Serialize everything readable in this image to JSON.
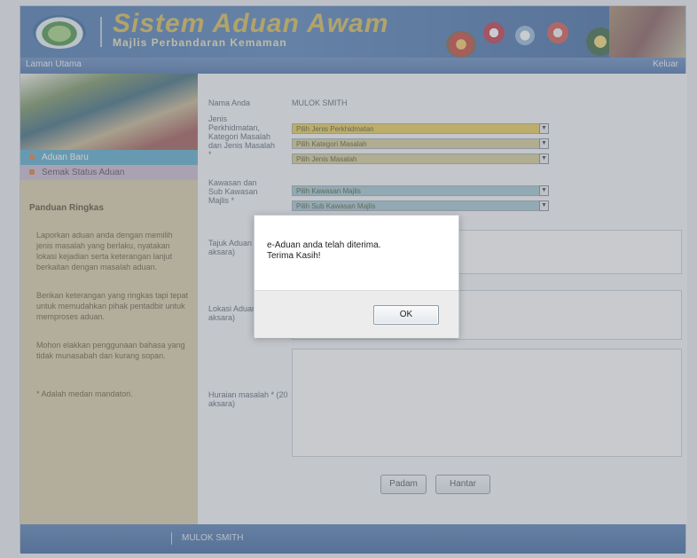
{
  "header": {
    "title": "Sistem Aduan Awam",
    "subtitle": "Majlis Perbandaran Kemaman"
  },
  "menubar": {
    "home": "Laman Utama",
    "logout": "Keluar"
  },
  "sidebar": {
    "nav": [
      {
        "label": "Aduan Baru"
      },
      {
        "label": "Semak Status Aduan"
      }
    ],
    "guide_title": "Panduan Ringkas",
    "guide": [
      "Laporkan aduan anda dengan memilih jenis masalah yang berlaku, nyatakan lokasi kejadian serta keterangan lanjut berkaitan dengan masalah aduan.",
      "Berikan keterangan yang ringkas tapi tepat untuk memudahkan pihak pentadbir untuk memproses aduan.",
      "Mohon elakkan penggunaan bahasa yang tidak munasabah dan kurang sopan.",
      "* Adalah medan mandatori."
    ]
  },
  "form": {
    "name_label": "Nama Anda",
    "name_value": "MULOK SMITH",
    "category_label": "Jenis Perkhidmatan, Kategori Masalah dan Jenis Masalah *",
    "selects_1": [
      {
        "text": "Pilih Jenis Perkhidmatan",
        "color": "#e8c94a"
      },
      {
        "text": "Pilih Kategori Masalah",
        "color": "#d2c98f"
      },
      {
        "text": "Pilih Jenis Masalah",
        "color": "#d2c98f"
      }
    ],
    "area_label": "Kawasan dan Sub Kawasan Majlis *",
    "selects_2": [
      {
        "text": "Pilih Kawasan Majlis",
        "color": "#9ac3ce"
      },
      {
        "text": "Pilih Sub Kawasan Majlis",
        "color": "#9ac3ce"
      }
    ],
    "title_label": "Tajuk Aduan * (10 aksara)",
    "location_label": "Lokasi Aduan * (20 aksara)",
    "desc_label": "Huraian masalah * (20 aksara)",
    "reset_label": "Padam",
    "submit_label": "Hantar"
  },
  "footer": {
    "text": "MULOK SMITH"
  },
  "dialog": {
    "message_line1": "e-Aduan anda telah diterima.",
    "message_line2": "Terima Kasih!",
    "ok_label": "OK"
  },
  "colors": {
    "header_blue": "#3f6dab",
    "sidebar_tan": "#d7c9a5",
    "nav_active": "#4ea7c9",
    "nav_inactive": "#c5b4cd"
  }
}
